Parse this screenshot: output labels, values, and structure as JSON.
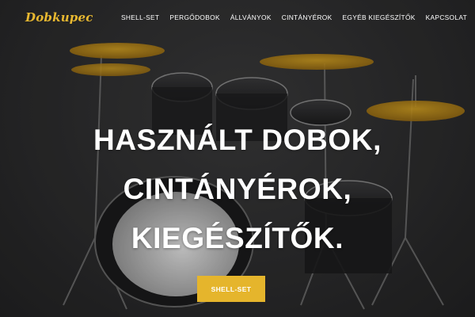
{
  "brand": {
    "logo_text": "Dobkupec"
  },
  "nav": {
    "items": [
      {
        "label": "SHELL-SET"
      },
      {
        "label": "PERGŐDOBOK"
      },
      {
        "label": "ÁLLVÁNYOK"
      },
      {
        "label": "CINTÁNYÉROK"
      },
      {
        "label": "EGYÉB KIEGÉSZÍTŐK"
      },
      {
        "label": "KAPCSOLAT"
      }
    ]
  },
  "hero": {
    "headline_lines": [
      "HASZNÁLT DOBOK,",
      "CINTÁNYÉROK,",
      "KIEGÉSZÍTŐK."
    ],
    "cta_label": "SHELL-SET",
    "background_icon": "drum-kit-image"
  },
  "colors": {
    "accent": "#e5b52c",
    "logo": "#e8b830",
    "background": "#2f2f30",
    "text": "#ffffff"
  }
}
